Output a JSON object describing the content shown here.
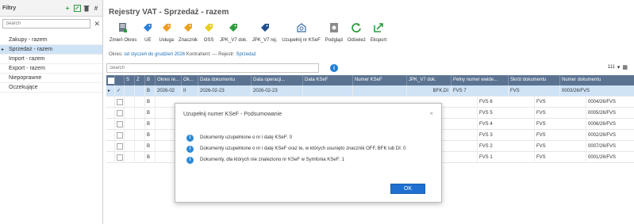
{
  "left_panel": {
    "title": "Filtry",
    "search_placeholder": "Search",
    "items": [
      {
        "label": "Zakupy - razem"
      },
      {
        "label": "Sprzedaż - razem"
      },
      {
        "label": "Import - razem"
      },
      {
        "label": "Export - razem"
      },
      {
        "label": "Niepoprawne"
      },
      {
        "label": "Oczekujące"
      }
    ]
  },
  "header": {
    "title": "Rejestry VAT - Sprzedaż - razem"
  },
  "toolbar": {
    "buttons": [
      {
        "label": "Zmień Okres",
        "icon": "calendar-icon"
      },
      {
        "label": "UE",
        "icon": "tag-blue-icon"
      },
      {
        "label": "Usługa",
        "icon": "tag-orange-icon"
      },
      {
        "label": "Znacznik",
        "icon": "tag-orange-icon"
      },
      {
        "label": "OSS",
        "icon": "tag-yellow-icon"
      },
      {
        "label": "JPK_V7 dok.",
        "icon": "tag-green-icon"
      },
      {
        "label": "JPK_V7 rej.",
        "icon": "tag-navy-icon"
      },
      {
        "label": "Uzupełnij nr KSeF",
        "icon": "ksef-icon"
      },
      {
        "label": "Podgląd",
        "icon": "preview-icon"
      },
      {
        "label": "Odśwież",
        "icon": "refresh-icon"
      },
      {
        "label": "Eksport",
        "icon": "export-icon"
      }
    ]
  },
  "info_line": {
    "okres_label": "Okres:",
    "okres_value": "od styczeń do grudzień 2026",
    "kontrahent_label": "Kontrahent:",
    "kontrahent_value": "---",
    "rejestr_label": "Rejestr:",
    "rejestr_value": "Sprzedaż"
  },
  "grid": {
    "search_placeholder": "Search",
    "page_size": "111",
    "columns": [
      "",
      "S",
      "Z",
      "B",
      "Okres re...",
      "Ok...",
      "Data dokumentu",
      "Data operacji...",
      "Data KSeF",
      "Numer KSeF",
      "JPK_V7 dok.",
      "Pełny numer ewide...",
      "Skrót dokumentu",
      "Numer dokumentu"
    ],
    "rows": [
      {
        "check": "✓",
        "b": "B",
        "okres": "2026-02",
        "ok": "II",
        "data_dok": "2026-02-23",
        "data_op": "2026-02-23",
        "jpk": "BFK,DI",
        "pelny": "FVS 7",
        "skrot": "FVS",
        "numer": "0003/26/FVS",
        "selected": true
      },
      {
        "check": "",
        "b": "B",
        "okres": "",
        "ok": "",
        "data_dok": "",
        "data_op": "",
        "jpk": "",
        "pelny": "FVS 6",
        "skrot": "FVS",
        "numer": "0004/26/FVS"
      },
      {
        "check": "",
        "b": "B",
        "okres": "",
        "ok": "",
        "data_dok": "",
        "data_op": "",
        "jpk": "",
        "pelny": "FVS 5",
        "skrot": "FVS",
        "numer": "0005/26/FVS"
      },
      {
        "check": "",
        "b": "B",
        "okres": "",
        "ok": "",
        "data_dok": "",
        "data_op": "",
        "jpk": "",
        "pelny": "FVS 4",
        "skrot": "FVS",
        "numer": "0006/26/FVS"
      },
      {
        "check": "",
        "b": "B",
        "okres": "",
        "ok": "",
        "data_dok": "",
        "data_op": "",
        "jpk": "",
        "pelny": "FVS 3",
        "skrot": "FVS",
        "numer": "0002/26/FVS"
      },
      {
        "check": "",
        "b": "B",
        "okres": "",
        "ok": "",
        "data_dok": "",
        "data_op": "",
        "jpk": "",
        "pelny": "FVS 2",
        "skrot": "FVS",
        "numer": "0007/26/FVS"
      },
      {
        "check": "",
        "b": "B",
        "okres": "",
        "ok": "",
        "data_dok": "",
        "data_op": "",
        "jpk": "",
        "pelny": "FVS 1",
        "skrot": "FVS",
        "numer": "0001/26/FVS"
      }
    ]
  },
  "modal": {
    "title": "Uzupełnij numer KSeF - Podsumowanie",
    "close": "×",
    "lines": [
      "Dokumenty uzupełnione o nr i datę KSeF: 0",
      "Dokumenty uzupełnione o nr i datę KSeF oraz te, w których usunięto znacznik OFF, BFK lub DI: 0",
      "Dokumenty, dla których nie znaleziono nr KSeF w Symfonia KSeF: 1"
    ],
    "ok_label": "OK"
  },
  "colors": {
    "header_bg": "#5b7391",
    "selected_row": "#cfe3f7",
    "accent_blue": "#1f6fd0",
    "link_blue": "#1a6fb8"
  }
}
